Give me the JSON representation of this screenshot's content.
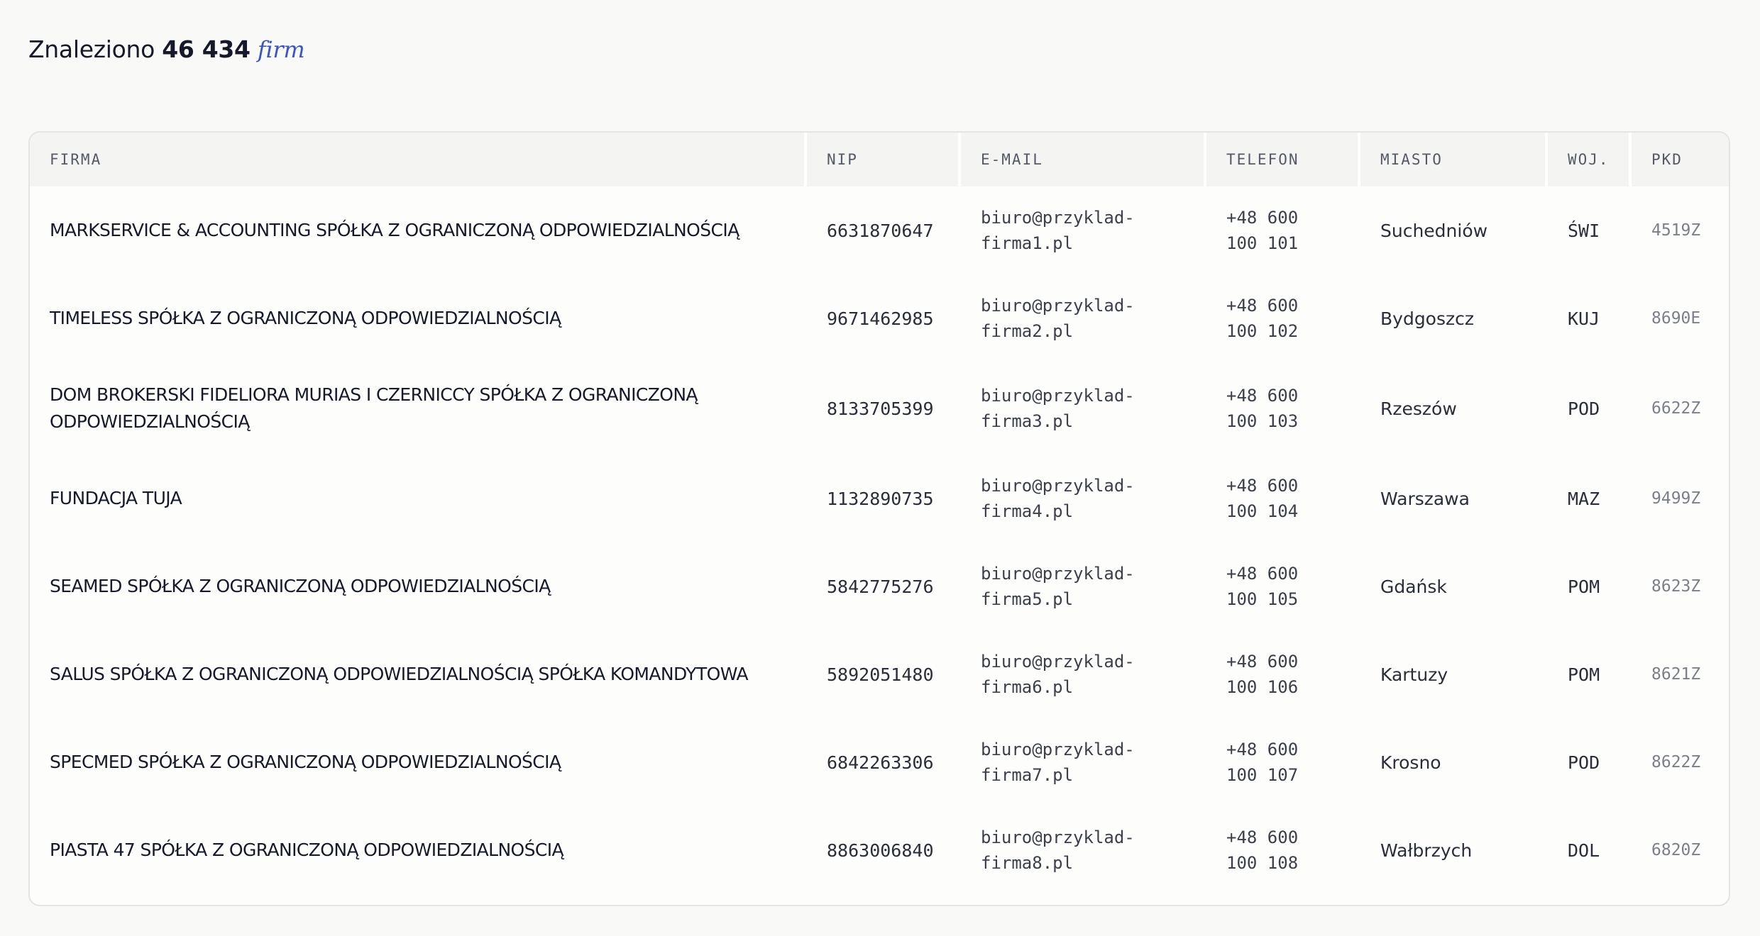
{
  "results": {
    "prefix": "Znaleziono",
    "count": "46 434",
    "unit": "firm"
  },
  "table": {
    "headers": {
      "firma": "FIRMA",
      "nip": "NIP",
      "email": "E-MAIL",
      "telefon": "TELEFON",
      "miasto": "MIASTO",
      "woj": "WOJ.",
      "pkd": "PKD"
    },
    "rows": [
      {
        "firma": "MARKSERVICE & ACCOUNTING SPÓŁKA Z OGRANICZONĄ ODPOWIEDZIALNOŚCIĄ",
        "nip": "6631870647",
        "email": "biuro@przyklad-\nfirma1.pl",
        "telefon": "+48 600\n100 101",
        "miasto": "Suchedniów",
        "woj": "ŚWI",
        "pkd": "4519Z"
      },
      {
        "firma": "TIMELESS SPÓŁKA Z OGRANICZONĄ ODPOWIEDZIALNOŚCIĄ",
        "nip": "9671462985",
        "email": "biuro@przyklad-\nfirma2.pl",
        "telefon": "+48 600\n100 102",
        "miasto": "Bydgoszcz",
        "woj": "KUJ",
        "pkd": "8690E"
      },
      {
        "firma": "DOM BROKERSKI FIDELIORA MURIAS I CZERNICCY SPÓŁKA Z OGRANICZONĄ ODPOWIEDZIALNOŚCIĄ",
        "nip": "8133705399",
        "email": "biuro@przyklad-\nfirma3.pl",
        "telefon": "+48 600\n100 103",
        "miasto": "Rzeszów",
        "woj": "POD",
        "pkd": "6622Z"
      },
      {
        "firma": "FUNDACJA TUJA",
        "nip": "1132890735",
        "email": "biuro@przyklad-\nfirma4.pl",
        "telefon": "+48 600\n100 104",
        "miasto": "Warszawa",
        "woj": "MAZ",
        "pkd": "9499Z"
      },
      {
        "firma": "SEAMED SPÓŁKA Z OGRANICZONĄ ODPOWIEDZIALNOŚCIĄ",
        "nip": "5842775276",
        "email": "biuro@przyklad-\nfirma5.pl",
        "telefon": "+48 600\n100 105",
        "miasto": "Gdańsk",
        "woj": "POM",
        "pkd": "8623Z"
      },
      {
        "firma": "SALUS SPÓŁKA Z OGRANICZONĄ ODPOWIEDZIALNOŚCIĄ SPÓŁKA KOMANDYTOWA",
        "nip": "5892051480",
        "email": "biuro@przyklad-\nfirma6.pl",
        "telefon": "+48 600\n100 106",
        "miasto": "Kartuzy",
        "woj": "POM",
        "pkd": "8621Z"
      },
      {
        "firma": "SPECMED SPÓŁKA Z OGRANICZONĄ ODPOWIEDZIALNOŚCIĄ",
        "nip": "6842263306",
        "email": "biuro@przyklad-\nfirma7.pl",
        "telefon": "+48 600\n100 107",
        "miasto": "Krosno",
        "woj": "POD",
        "pkd": "8622Z"
      },
      {
        "firma": "PIASTA 47 SPÓŁKA Z OGRANICZONĄ ODPOWIEDZIALNOŚCIĄ",
        "nip": "8863006840",
        "email": "biuro@przyklad-\nfirma8.pl",
        "telefon": "+48 600\n100 108",
        "miasto": "Wałbrzych",
        "woj": "DOL",
        "pkd": "6820Z"
      }
    ]
  }
}
